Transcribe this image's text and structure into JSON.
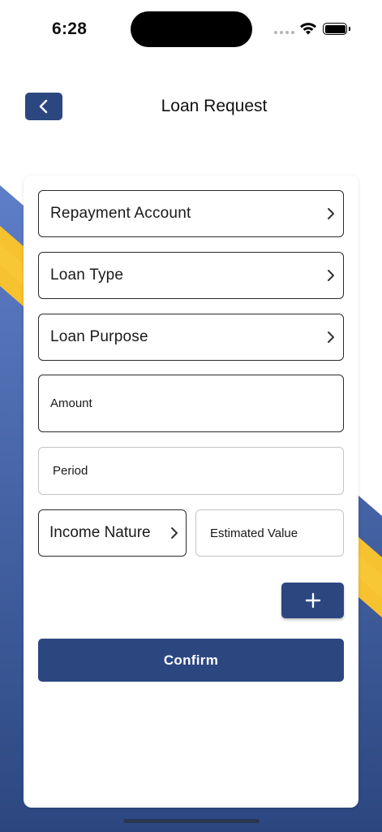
{
  "status_bar": {
    "time": "6:28"
  },
  "header": {
    "title": "Loan Request"
  },
  "form": {
    "repayment_account": "Repayment Account",
    "loan_type": "Loan Type",
    "loan_purpose": "Loan Purpose",
    "amount_placeholder": "Amount",
    "period_placeholder": "Period",
    "income_nature": "Income Nature",
    "estimated_value_placeholder": "Estimated Value",
    "add_label": "+",
    "confirm_label": "Confirm"
  },
  "colors": {
    "primary": "#2c4780",
    "accent": "#f6c230",
    "band_top": "#5a7ac4",
    "band_bottom": "#2c4780"
  },
  "icons": [
    "back-chevron-icon",
    "chevron-right-icon",
    "plus-icon",
    "wifi-icon",
    "battery-icon",
    "signal-icon"
  ]
}
